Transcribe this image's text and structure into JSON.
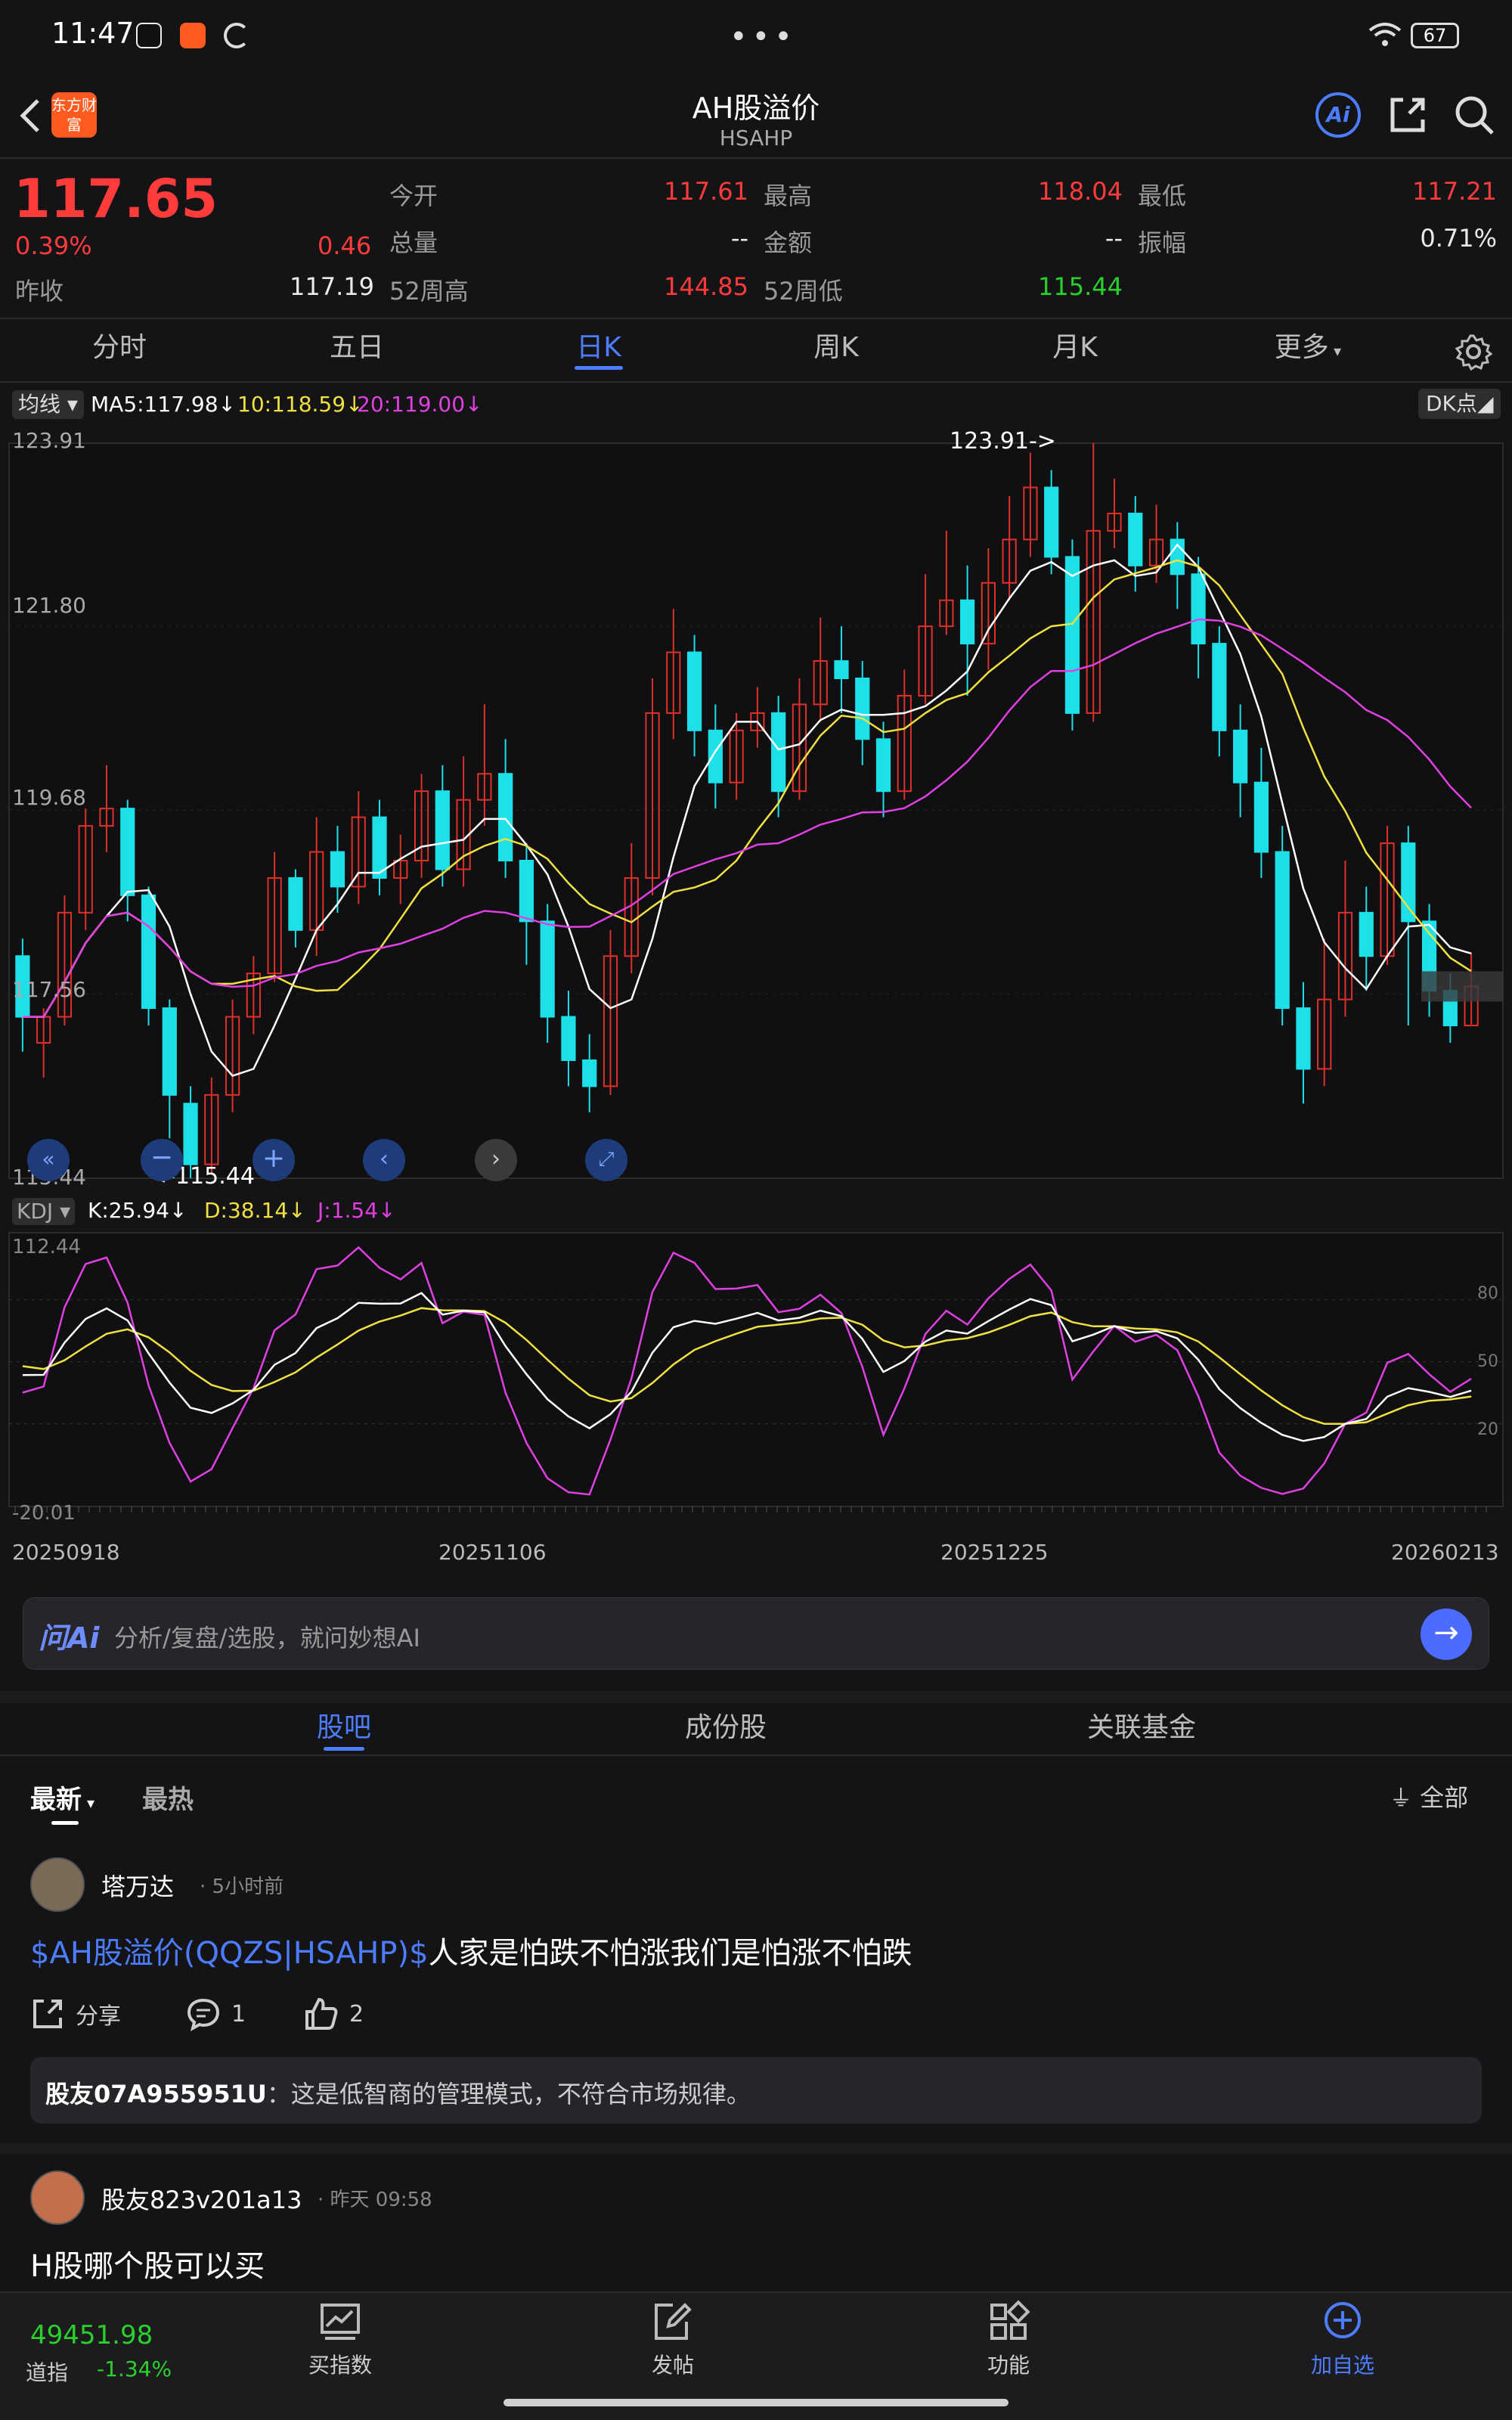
{
  "status": {
    "time": "11:47",
    "battery": "67"
  },
  "header": {
    "title": "AH股溢价",
    "subtitle": "HSAHP",
    "brand": "东方财富",
    "ai": "Ai"
  },
  "quote": {
    "price": "117.65",
    "pct": "0.39%",
    "chg": "0.46",
    "prev_label": "昨收",
    "prev": "117.19",
    "open_label": "今开",
    "open": "117.61",
    "high_label": "最高",
    "high": "118.04",
    "low_label": "最低",
    "low": "117.21",
    "vol_label": "总量",
    "vol": "--",
    "amt_label": "金额",
    "amt": "--",
    "amp_label": "振幅",
    "amp": "0.71%",
    "h52_label": "52周高",
    "h52": "144.85",
    "l52_label": "52周低",
    "l52": "115.44"
  },
  "tabs": [
    "分时",
    "五日",
    "日K",
    "周K",
    "月K",
    "更多"
  ],
  "ma": {
    "label": "均线",
    "ma5": "MA5:117.98",
    "ma10": "10:118.59",
    "ma20": "20:119.00",
    "dk": "DK点"
  },
  "price_axis": [
    "123.91",
    "121.80",
    "119.68",
    "117.56",
    "115.44"
  ],
  "markers": {
    "high": "123.91->",
    "low": "<-115.44"
  },
  "kdj": {
    "label": "KDJ",
    "k": "K:25.94",
    "d": "D:38.14",
    "j": "J:1.54",
    "top": "112.44",
    "bottom": "-20.01",
    "r80": "80",
    "r50": "50",
    "r20": "20"
  },
  "dates": [
    "20250918",
    "20251106",
    "20251225",
    "20260213"
  ],
  "ask": {
    "logo": "问Ai",
    "placeholder": "分析/复盘/选股，就问妙想AI"
  },
  "ptabs": [
    "股吧",
    "成份股",
    "关联基金"
  ],
  "filter": {
    "latest": "最新",
    "hot": "最热",
    "all": "全部"
  },
  "posts": [
    {
      "user": "塔万达",
      "time": "5小时前",
      "link": "$AH股溢价(QQZS|HSAHP)$",
      "text": "人家是怕跌不怕涨我们是怕涨不怕跌",
      "share": "分享",
      "comments": "1",
      "likes": "2",
      "reply_user": "股友07A955951U",
      "reply_text": "：这是低智商的管理模式，不符合市场规律。"
    },
    {
      "user": "股友823v201a13",
      "time": "昨天 09:58",
      "text": "H股哪个股可以买"
    }
  ],
  "bottom": {
    "index_value": "49451.98",
    "index_name": "道指",
    "index_pct": "-1.34%",
    "buy": "买指数",
    "post": "发帖",
    "func": "功能",
    "add": "加自选"
  },
  "chart_data": {
    "type": "candlestick",
    "ylim": [
      115.44,
      123.91
    ],
    "x_start": "20250918",
    "x_end": "20260213",
    "candles": [
      [
        118.0,
        117.3,
        118.2,
        116.9
      ],
      [
        117.0,
        117.3,
        117.4,
        116.6
      ],
      [
        117.3,
        118.5,
        118.7,
        117.2
      ],
      [
        118.5,
        119.5,
        119.7,
        118.3
      ],
      [
        119.5,
        119.7,
        120.2,
        119.2
      ],
      [
        119.7,
        118.7,
        119.8,
        118.4
      ],
      [
        118.7,
        117.4,
        118.8,
        117.2
      ],
      [
        117.4,
        116.4,
        117.5,
        115.9
      ],
      [
        116.3,
        115.6,
        116.5,
        115.44
      ],
      [
        115.6,
        116.4,
        116.6,
        115.5
      ],
      [
        116.4,
        117.3,
        117.5,
        116.2
      ],
      [
        117.3,
        117.8,
        118.0,
        117.1
      ],
      [
        117.8,
        118.9,
        119.2,
        117.7
      ],
      [
        118.9,
        118.3,
        119.0,
        118.1
      ],
      [
        118.3,
        119.2,
        119.6,
        118.0
      ],
      [
        119.2,
        118.8,
        119.5,
        118.5
      ],
      [
        118.8,
        119.6,
        119.9,
        118.6
      ],
      [
        119.6,
        118.9,
        119.8,
        118.7
      ],
      [
        118.9,
        119.1,
        119.4,
        118.6
      ],
      [
        119.1,
        119.9,
        120.1,
        118.9
      ],
      [
        119.9,
        119.0,
        120.2,
        118.8
      ],
      [
        119.0,
        119.8,
        120.3,
        118.8
      ],
      [
        119.8,
        120.1,
        120.9,
        119.5
      ],
      [
        120.1,
        119.1,
        120.5,
        118.9
      ],
      [
        119.1,
        118.4,
        119.3,
        117.9
      ],
      [
        118.4,
        117.3,
        118.6,
        117.0
      ],
      [
        117.3,
        116.8,
        117.6,
        116.5
      ],
      [
        116.8,
        116.5,
        117.1,
        116.2
      ],
      [
        116.5,
        118.0,
        118.3,
        116.4
      ],
      [
        118.0,
        118.9,
        119.3,
        117.8
      ],
      [
        118.9,
        120.8,
        121.2,
        118.7
      ],
      [
        120.8,
        121.5,
        122.0,
        120.5
      ],
      [
        121.5,
        120.6,
        121.7,
        120.3
      ],
      [
        120.6,
        120.0,
        120.9,
        119.7
      ],
      [
        120.0,
        120.6,
        120.8,
        119.8
      ],
      [
        120.6,
        120.8,
        121.1,
        120.4
      ],
      [
        120.8,
        119.9,
        121.0,
        119.6
      ],
      [
        119.9,
        120.9,
        121.2,
        119.8
      ],
      [
        120.9,
        121.4,
        121.9,
        120.7
      ],
      [
        121.4,
        121.2,
        121.8,
        120.8
      ],
      [
        121.2,
        120.5,
        121.4,
        120.2
      ],
      [
        120.5,
        119.9,
        120.7,
        119.6
      ],
      [
        119.9,
        121.0,
        121.3,
        119.8
      ],
      [
        121.0,
        121.8,
        122.4,
        120.9
      ],
      [
        121.8,
        122.1,
        122.9,
        121.7
      ],
      [
        122.1,
        121.6,
        122.5,
        121.0
      ],
      [
        121.6,
        122.3,
        122.7,
        121.3
      ],
      [
        122.3,
        122.8,
        123.3,
        122.1
      ],
      [
        122.8,
        123.4,
        123.8,
        122.6
      ],
      [
        123.4,
        122.6,
        123.6,
        122.4
      ],
      [
        122.6,
        120.8,
        122.8,
        120.6
      ],
      [
        120.8,
        122.9,
        123.91,
        120.7
      ],
      [
        122.9,
        123.1,
        123.5,
        122.7
      ],
      [
        123.1,
        122.5,
        123.3,
        122.2
      ],
      [
        122.5,
        122.8,
        123.2,
        122.3
      ],
      [
        122.8,
        122.4,
        123.0,
        122.0
      ],
      [
        122.4,
        121.6,
        122.6,
        121.2
      ],
      [
        121.6,
        120.6,
        121.8,
        120.3
      ],
      [
        120.6,
        120.0,
        120.9,
        119.6
      ],
      [
        120.0,
        119.2,
        120.4,
        118.9
      ],
      [
        119.2,
        117.4,
        119.5,
        117.2
      ],
      [
        117.4,
        116.7,
        117.7,
        116.3
      ],
      [
        116.7,
        117.5,
        118.2,
        116.5
      ],
      [
        117.5,
        118.5,
        119.1,
        117.3
      ],
      [
        118.5,
        118.0,
        118.8,
        117.6
      ],
      [
        118.0,
        119.3,
        119.5,
        117.9
      ],
      [
        119.3,
        118.4,
        119.5,
        117.2
      ],
      [
        118.4,
        117.6,
        118.6,
        117.3
      ],
      [
        117.6,
        117.2,
        117.8,
        117.0
      ],
      [
        117.2,
        117.65,
        118.04,
        117.21
      ]
    ]
  }
}
